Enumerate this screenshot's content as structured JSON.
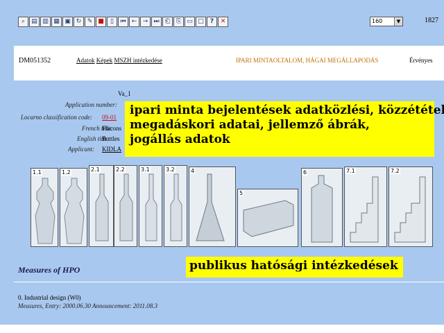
{
  "toolbar": {
    "icons": [
      "search-icon",
      "open-folder-icon",
      "print-icon",
      "image-icon",
      "floppy-disk-icon",
      "refresh-icon",
      "edit-icon",
      "lock-icon",
      "document-icon",
      "first-icon",
      "previous-icon",
      "next-icon",
      "last-icon",
      "copy-icon",
      "export-icon",
      "page-icon",
      "window-icon",
      "help-icon",
      "close-icon"
    ],
    "zoom": "160",
    "count": "1827"
  },
  "header": {
    "doc_id": "DM051352",
    "breadcrumb_data": "Adatok",
    "breadcrumb_images": "Képek",
    "breadcrumb_measures": "MSZH intézkedése",
    "doc_type": "IPARI MINTAOLTALOM, HÁGAI MEGÁLLAPODÁS",
    "status": "Érvényes"
  },
  "details": {
    "va_label": "Va_1",
    "fields": [
      {
        "label": "Application number:",
        "value": ""
      },
      {
        "label": "Locarno classification code:",
        "value": "09-01"
      },
      {
        "label": "French title:",
        "value": "Flacons"
      },
      {
        "label": "English title:",
        "value": "Bottles"
      },
      {
        "label": "Applicant:",
        "value": "KIDLA"
      }
    ]
  },
  "callouts": {
    "main_lines": [
      "ipari minta bejelentések adatközlési, közzétételi,",
      "megadáskori adatai, jellemző ábrák,",
      "jogállás adatok"
    ],
    "bottom": "publikus hatósági intézkedések"
  },
  "thumbnails": [
    "1.1",
    "1.2",
    "2.1",
    "2.2",
    "3.1",
    "3.2",
    "4",
    "5",
    "6",
    "7.1",
    "7.2"
  ],
  "measures": {
    "title": "Measures of HPO",
    "item": "0. Industrial design (W0)",
    "dates": "Measures, Entry: 2000.06.30  Announcement: 2011.08.3"
  }
}
